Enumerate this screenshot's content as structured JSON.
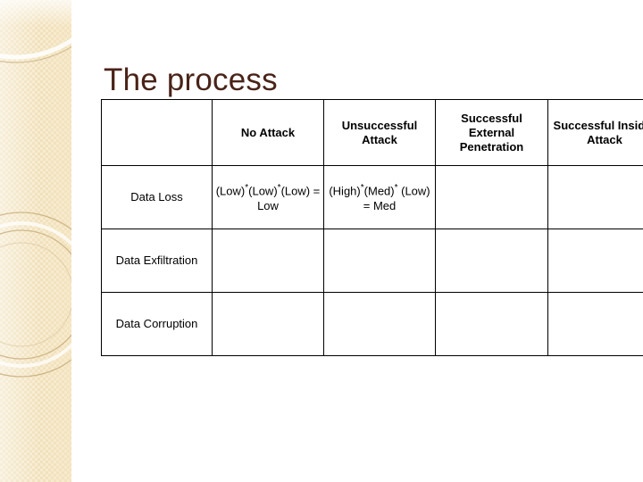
{
  "slide": {
    "title": "The process",
    "title_color": "#4a2318",
    "background_color": "#ffffff",
    "band_color": "#f7ecd0"
  },
  "table": {
    "headers": [
      {
        "label": "",
        "bold": false
      },
      {
        "label": "No Attack",
        "bold": true
      },
      {
        "label": "Unsuccessful Attack",
        "bold": false
      },
      {
        "label": "Successful External Penetration",
        "bold": true
      },
      {
        "label": "Successful Insider Attack",
        "bold": true
      }
    ],
    "rows": [
      {
        "label": "Data Loss",
        "cells": [
          "(Low)*(Low)*(Low) = Low",
          "(High)*(Med)* (Low) = Med",
          "",
          ""
        ]
      },
      {
        "label": "Data Exfiltration",
        "cells": [
          "",
          "",
          "",
          ""
        ]
      },
      {
        "label": "Data Corruption",
        "cells": [
          "",
          "",
          "",
          ""
        ]
      }
    ]
  }
}
